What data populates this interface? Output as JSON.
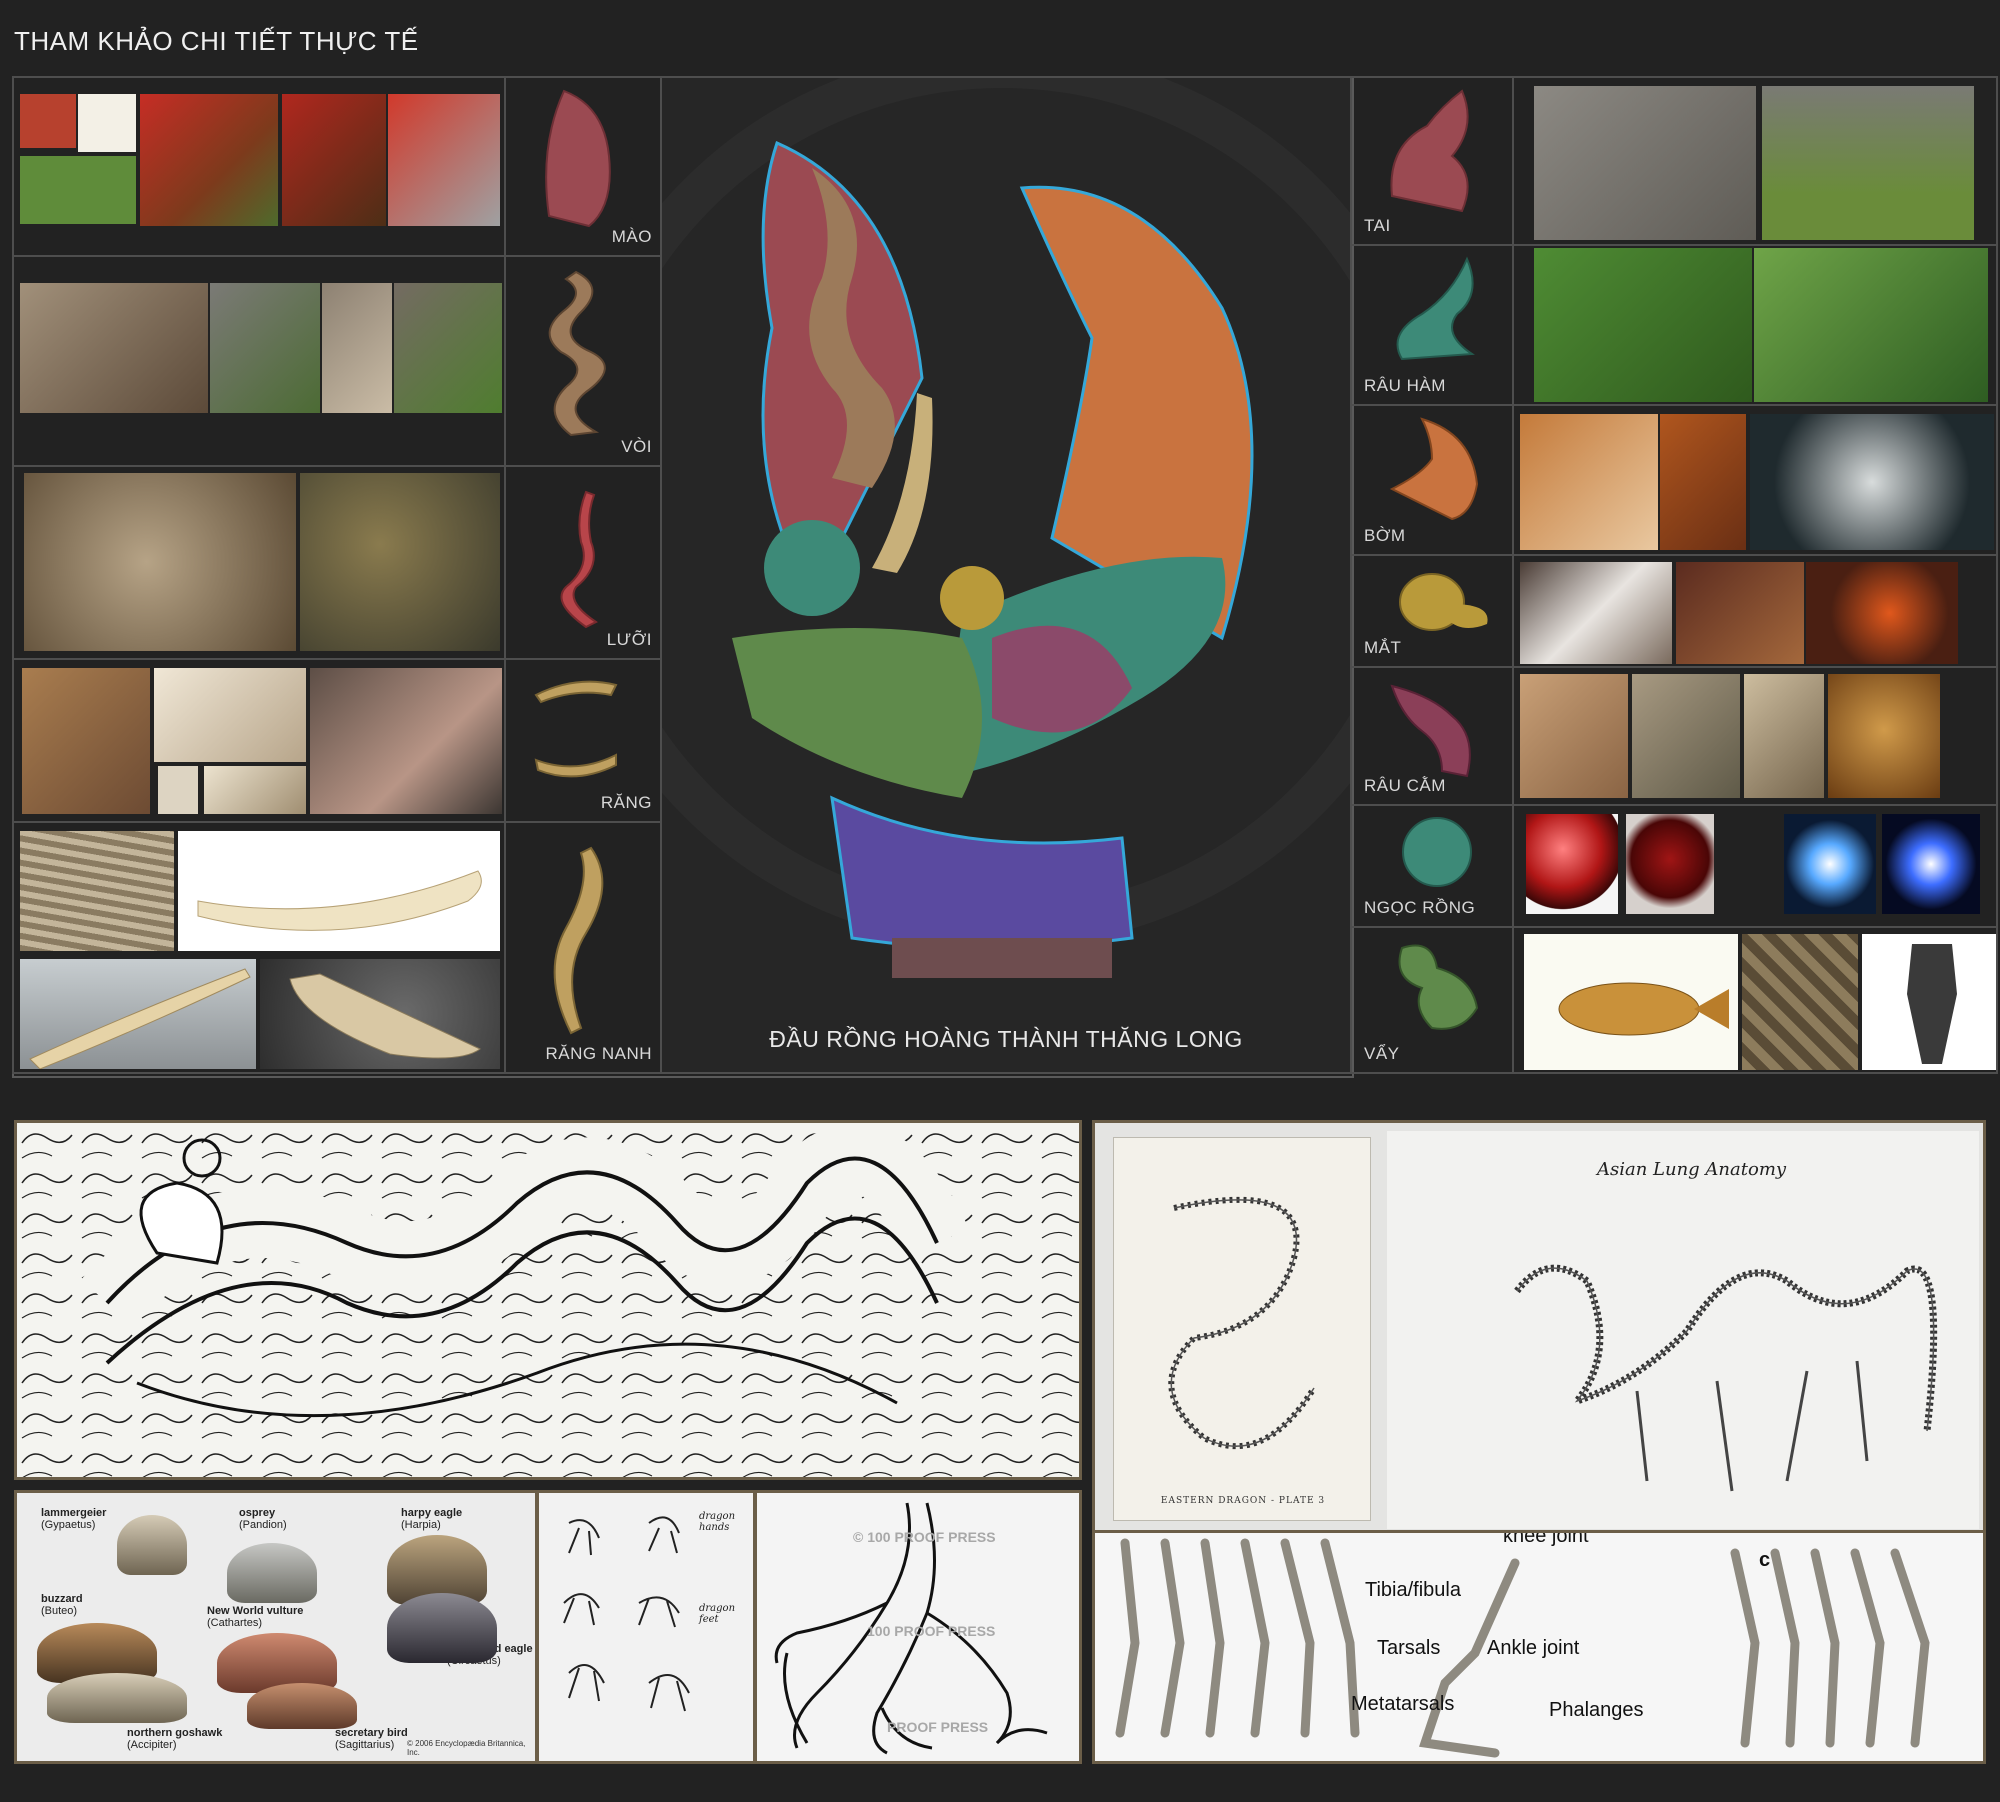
{
  "page_title": "THAM KHẢO CHI TIẾT THỰC TẾ",
  "center_caption": "ĐẦU RỒNG HOÀNG THÀNH THĂNG LONG",
  "left_parts": [
    {
      "label": "MÀO"
    },
    {
      "label": "VÒI"
    },
    {
      "label": "LƯỠI"
    },
    {
      "label": "RĂNG"
    },
    {
      "label": "RĂNG NANH"
    }
  ],
  "right_parts": [
    {
      "label": "TAI"
    },
    {
      "label": "RÂU HÀM"
    },
    {
      "label": "BỜM"
    },
    {
      "label": "MẮT"
    },
    {
      "label": "RÂU CẰM"
    },
    {
      "label": "NGỌC RỒNG"
    },
    {
      "label": "VẨY"
    }
  ],
  "lung_anatomy": {
    "title": "Asian Lung Anatomy",
    "plate_caption": "EASTERN DRAGON - PLATE 3"
  },
  "leg_anatomy": {
    "labels": [
      "knee joint",
      "Tibia/fibula",
      "Tarsals",
      "Ankle joint",
      "Metatarsals",
      "Phalanges",
      "c"
    ]
  },
  "talons": {
    "labels": [
      {
        "name": "lammergeier",
        "latin": "(Gypaetus)"
      },
      {
        "name": "osprey",
        "latin": "(Pandion)"
      },
      {
        "name": "harpy eagle",
        "latin": "(Harpia)"
      },
      {
        "name": "buzzard",
        "latin": "(Buteo)"
      },
      {
        "name": "New World vulture",
        "latin": "(Cathartes)"
      },
      {
        "name": "short-toed eagle",
        "latin": "(Circaetus)"
      },
      {
        "name": "northern goshawk",
        "latin": "(Accipiter)"
      },
      {
        "name": "secretary bird",
        "latin": "(Sagittarius)"
      }
    ],
    "copyright": "© 2006 Encyclopædia Britannica, Inc."
  },
  "sketch_labels": [
    "dragon hands",
    "dragon feet"
  ],
  "watermark": [
    "© 100 PROOF PRESS",
    "100 PROOF PRESS",
    "PROOF PRESS"
  ],
  "colors": {
    "background": "#222222",
    "crest": "#9b4a52",
    "trunk": "#9c7a5a",
    "mane": "#c9733f",
    "jaw": "#3d8a78",
    "eye": "#b99a3a",
    "neck": "#5a4aa0"
  }
}
